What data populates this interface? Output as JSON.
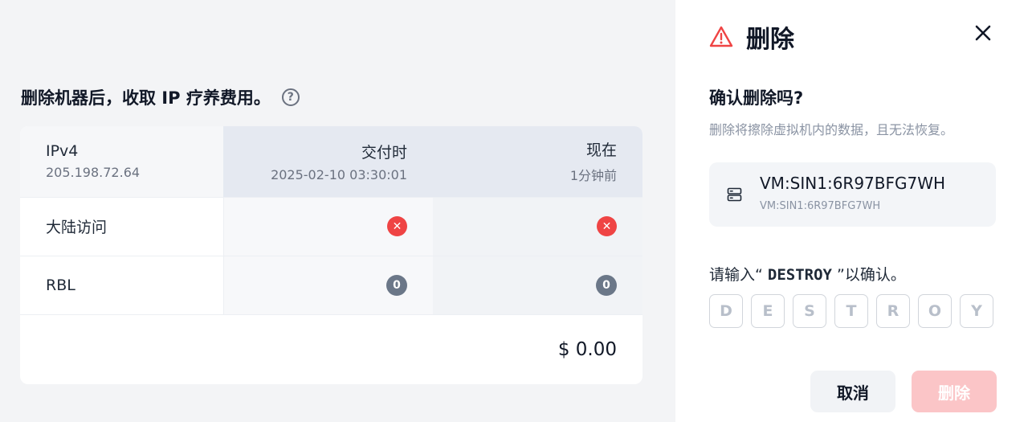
{
  "fee": {
    "title": "删除机器后，收取 IP 疗养费用。",
    "help_icon": "?",
    "columns": [
      {
        "label": "IPv4",
        "sub": "205.198.72.64"
      },
      {
        "label": "交付时",
        "sub": "2025-02-10 03:30:01"
      },
      {
        "label": "现在",
        "sub": "1分钟前"
      }
    ],
    "rows": [
      {
        "label": "大陆访问",
        "delivery": "✕",
        "now": "✕",
        "status_icon": "x-circle-icon",
        "status_color": "#ef4444"
      },
      {
        "label": "RBL",
        "delivery": "0",
        "now": "0",
        "status_icon": "count-badge",
        "status_color": "#6b7788"
      }
    ],
    "total": "$ 0.00"
  },
  "dialog": {
    "title": "删除",
    "warning_color": "#ef4444",
    "confirm_question": "确认删除吗?",
    "confirm_description": "删除将擦除虚拟机内的数据，且无法恢复。",
    "vm": {
      "name": "VM:SIN1:6R97BFG7WH",
      "id": "VM:SIN1:6R97BFG7WH"
    },
    "destroy_prompt_prefix": "请输入“ ",
    "destroy_prompt_code": "DESTROY",
    "destroy_prompt_suffix": " ”以确认。",
    "code_placeholders": [
      "D",
      "E",
      "S",
      "T",
      "R",
      "O",
      "Y"
    ],
    "cancel_label": "取消",
    "delete_label": "删除",
    "delete_color": "#fbc5c7"
  }
}
